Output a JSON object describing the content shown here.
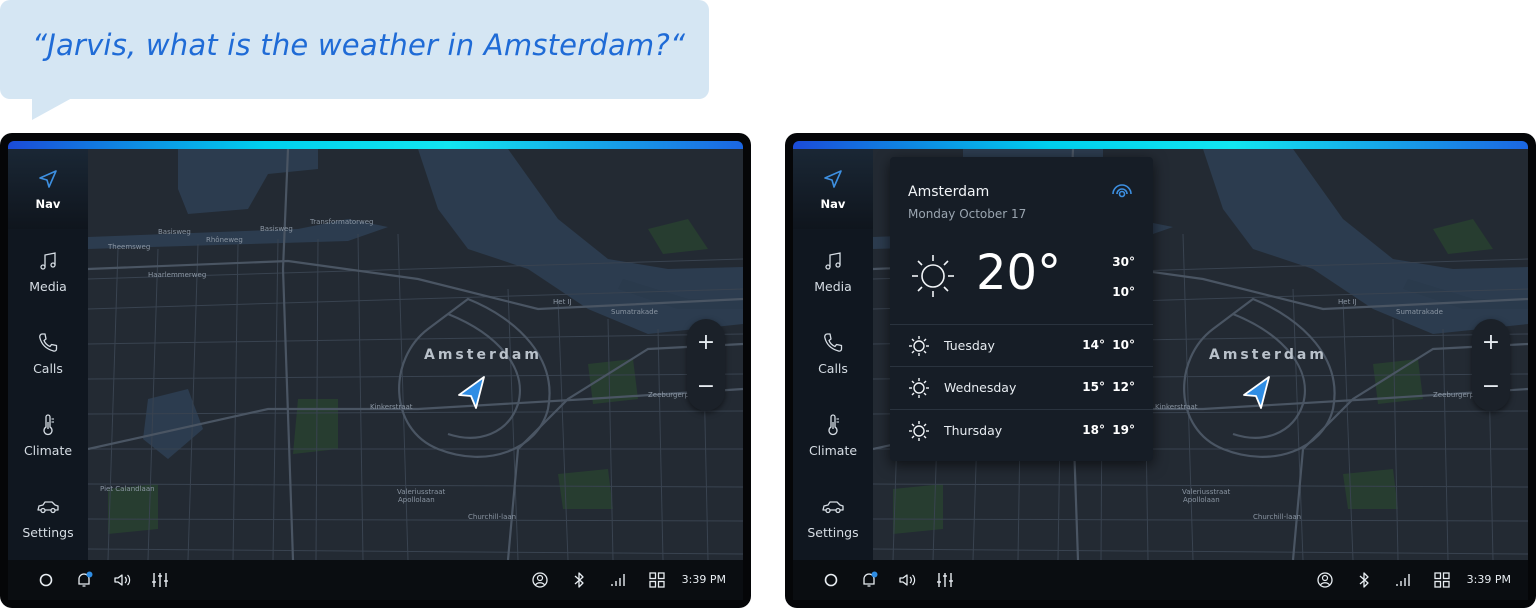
{
  "prompt": {
    "text": "“Jarvis, what is the weather in Amsterdam?“"
  },
  "sidebar": {
    "items": [
      {
        "label": "Nav",
        "icon": "navigation-arrow-icon",
        "active": true
      },
      {
        "label": "Media",
        "icon": "music-note-icon",
        "active": false
      },
      {
        "label": "Calls",
        "icon": "phone-icon",
        "active": false
      },
      {
        "label": "Climate",
        "icon": "thermometer-icon",
        "active": false
      },
      {
        "label": "Settings",
        "icon": "car-icon",
        "active": false
      }
    ]
  },
  "map": {
    "city_label": "Amsterdam",
    "zoom_in": "+",
    "zoom_out": "−"
  },
  "bottombar": {
    "time": "3:39 PM",
    "icons": [
      "home-circle-icon",
      "notification-bell-icon",
      "volume-icon",
      "equalizer-icon",
      "profile-icon",
      "bluetooth-icon",
      "signal-icon",
      "apps-grid-icon"
    ]
  },
  "weather": {
    "city": "Amsterdam",
    "date": "Monday October 17",
    "current_temp": "20°",
    "high": "30°",
    "low": "10°",
    "forecast": [
      {
        "day": "Tuesday",
        "high": "14°",
        "low": "10°"
      },
      {
        "day": "Wednesday",
        "high": "15°",
        "low": "12°"
      },
      {
        "day": "Thursday",
        "high": "18°",
        "low": "19°"
      }
    ]
  },
  "colors": {
    "accent_blue": "#3d8fe0",
    "bubble_bg": "#d5e6f3",
    "bubble_text": "#1f6bd6",
    "glow_cyan": "#12e6f0",
    "map_bg": "#232a33",
    "sidebar_bg": "#101720"
  }
}
